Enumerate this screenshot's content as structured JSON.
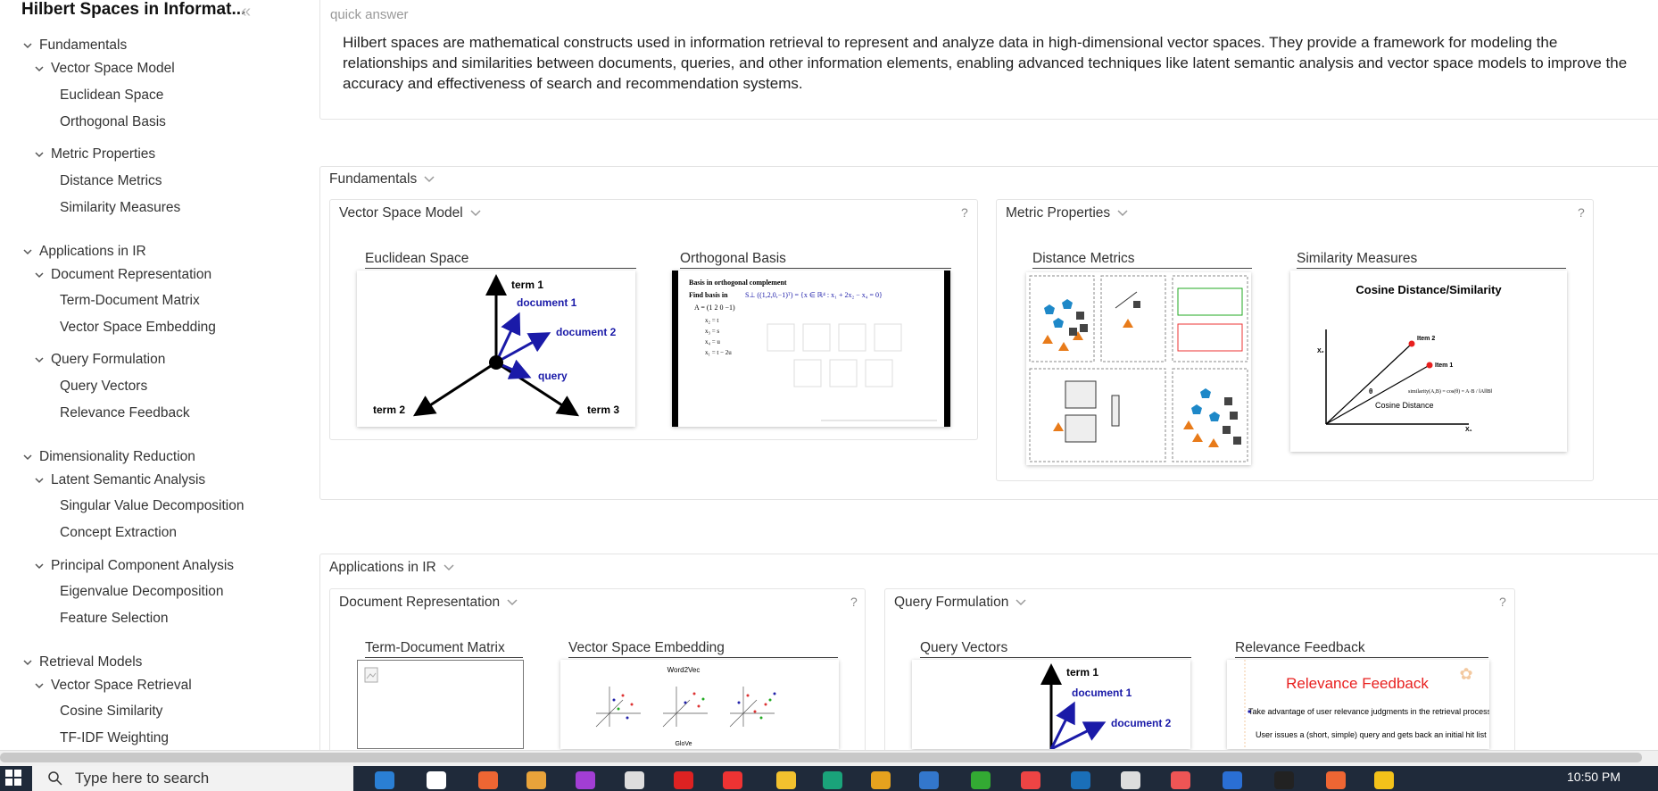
{
  "sidebar": {
    "title": "Hilbert Spaces in Informat...",
    "items": [
      {
        "label": "Fundamentals",
        "level": 0,
        "expanded": true
      },
      {
        "label": "Vector Space Model",
        "level": 1,
        "expanded": true
      },
      {
        "label": "Euclidean Space",
        "level": 2
      },
      {
        "label": "Orthogonal Basis",
        "level": 2
      },
      {
        "label": "Metric Properties",
        "level": 1,
        "expanded": true
      },
      {
        "label": "Distance Metrics",
        "level": 2
      },
      {
        "label": "Similarity Measures",
        "level": 2
      },
      {
        "label": "Applications in IR",
        "level": 0,
        "expanded": true
      },
      {
        "label": "Document Representation",
        "level": 1,
        "expanded": true
      },
      {
        "label": "Term-Document Matrix",
        "level": 2
      },
      {
        "label": "Vector Space Embedding",
        "level": 2
      },
      {
        "label": "Query Formulation",
        "level": 1,
        "expanded": true
      },
      {
        "label": "Query Vectors",
        "level": 2
      },
      {
        "label": "Relevance Feedback",
        "level": 2
      },
      {
        "label": "Dimensionality Reduction",
        "level": 0,
        "expanded": true
      },
      {
        "label": "Latent Semantic Analysis",
        "level": 1,
        "expanded": true
      },
      {
        "label": "Singular Value Decomposition",
        "level": 2
      },
      {
        "label": "Concept Extraction",
        "level": 2
      },
      {
        "label": "Principal Component Analysis",
        "level": 1,
        "expanded": true
      },
      {
        "label": "Eigenvalue Decomposition",
        "level": 2
      },
      {
        "label": "Feature Selection",
        "level": 2
      },
      {
        "label": "Retrieval Models",
        "level": 0,
        "expanded": true
      },
      {
        "label": "Vector Space Retrieval",
        "level": 1,
        "expanded": true
      },
      {
        "label": "Cosine Similarity",
        "level": 2
      },
      {
        "label": "TF-IDF Weighting",
        "level": 2
      }
    ]
  },
  "quick_answer": {
    "label": "quick answer",
    "text": "Hilbert spaces are mathematical constructs used in information retrieval to represent and analyze data in high-dimensional vector spaces. They provide a framework for modeling the relationships and similarities between documents, queries, and other information elements, enabling advanced techniques like latent semantic analysis and vector space models to improve the accuracy and effectiveness of search and recommendation systems."
  },
  "sections": {
    "fundamentals": {
      "label": "Fundamentals",
      "vsm": {
        "label": "Vector Space Model",
        "help": "?",
        "cards": [
          "Euclidean Space",
          "Orthogonal Basis"
        ]
      },
      "metric": {
        "label": "Metric Properties",
        "help": "?",
        "cards": [
          "Distance Metrics",
          "Similarity Measures"
        ]
      }
    },
    "applications": {
      "label": "Applications in IR",
      "docrep": {
        "label": "Document Representation",
        "help": "?",
        "cards": [
          "Term-Document Matrix",
          "Vector Space Embedding"
        ]
      },
      "query": {
        "label": "Query Formulation",
        "help": "?",
        "cards": [
          "Query Vectors",
          "Relevance Feedback"
        ]
      }
    }
  },
  "thumbs": {
    "euclid": {
      "t1": "term 1",
      "t2": "term 2",
      "t3": "term 3",
      "d1": "document 1",
      "d2": "document 2",
      "q": "query"
    },
    "ortho": {
      "l1": "Basis in orthogonal complement",
      "l2": "Find basis in"
    },
    "cosine": {
      "title": "Cosine Distance/Similarity",
      "i1": "Item 1",
      "i2": "Item 2",
      "cd": "Cosine Distance",
      "x1": "X₁",
      "x2": "X₂"
    },
    "w2v": {
      "title": "Word2Vec",
      "sub": "GloVe"
    },
    "qv": {
      "t1": "term 1",
      "d1": "document 1",
      "d2": "document 2"
    },
    "rf": {
      "title": "Relevance Feedback",
      "b1": "Take advantage of user relevance judgments in the retrieval process:",
      "b2": "User issues a (short, simple) query and gets back an initial hit list"
    }
  },
  "taskbar": {
    "search_placeholder": "Type here to search",
    "clock": "10:50 PM"
  },
  "colors": {
    "accent_blue": "#1a1aa8",
    "relevance_red": "#e8201f"
  }
}
